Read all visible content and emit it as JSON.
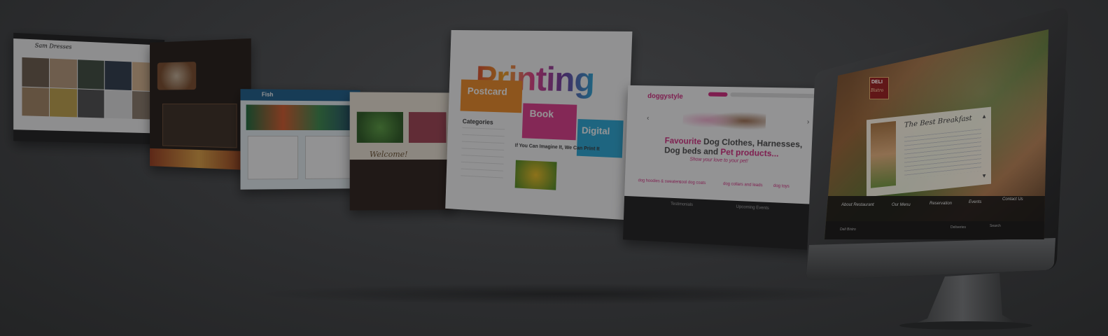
{
  "panels": {
    "fashion": {
      "logo": "Sam Dresses"
    },
    "print": {
      "brand": "Printing",
      "postcard": "Postcard",
      "book": "Book",
      "digital": "Digital",
      "categories": "Categories",
      "headline": "If You Can Imagine It, We Can Print It"
    },
    "pet": {
      "logo": "doggystyle",
      "headline_a": "Favourite",
      "headline_b": " Dog Clothes, Harnesses,",
      "headline_c": "Dog beds and ",
      "headline_d": "Pet products...",
      "tagline": "Show your love to your pet!",
      "items": [
        "dog hoodies & sweaters",
        "cool dog coats",
        "dog collars and leads",
        "dog toys"
      ],
      "section_a": "Testimonials",
      "section_b": "Upcoming Events"
    },
    "wine": {
      "label": "Welcome!"
    },
    "fish": {
      "logo": "Fish"
    }
  },
  "monitor": {
    "logo_top": "DELI",
    "logo_bottom": "Bistro",
    "card_title": "The Best Breakfast",
    "nav": [
      "About Restaurant",
      "Our Menu",
      "Reservation",
      "Events",
      "Contact Us"
    ],
    "footer_left": "Deli Bistro",
    "footer_mid": "Deliveries",
    "footer_right": "Search"
  },
  "colors": {
    "background": "#2b2c2e",
    "print_orange": "#f08a24",
    "print_pink": "#e03a8a",
    "print_blue": "#27a8d8",
    "pet_pink": "#d6277e",
    "pet_purple": "#6b2e7a"
  }
}
